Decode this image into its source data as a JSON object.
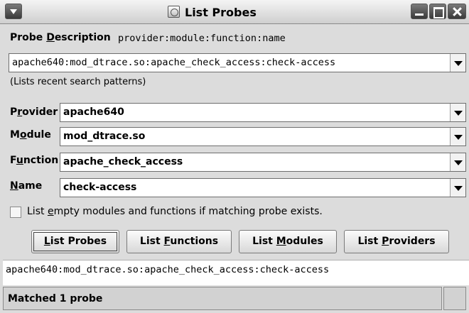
{
  "window": {
    "title": "List Probes"
  },
  "probe_description": {
    "label_prefix": "Probe ",
    "label_mnemonic": "D",
    "label_rest": "escription",
    "format": "provider:module:function:name",
    "value": "apache640:mod_dtrace.so:apache_check_access:check-access",
    "hint": "(Lists recent search patterns)"
  },
  "fields": {
    "provider": {
      "label_pre": "P",
      "label_mnemonic": "r",
      "label_post": "ovider",
      "value": "apache640"
    },
    "module": {
      "label_pre": "M",
      "label_mnemonic": "o",
      "label_post": "dule",
      "value": "mod_dtrace.so"
    },
    "function": {
      "label_pre": "F",
      "label_mnemonic": "u",
      "label_post": "nction",
      "value": "apache_check_access"
    },
    "name": {
      "label_pre": "",
      "label_mnemonic": "N",
      "label_post": "ame",
      "value": "check-access"
    }
  },
  "checkbox": {
    "pre": "List ",
    "mnemonic": "e",
    "post": "mpty modules and functions if matching probe exists.",
    "checked": false
  },
  "buttons": {
    "list_probes": {
      "pre": "",
      "mnemonic": "L",
      "post": "ist Probes"
    },
    "list_functions": {
      "pre": "List ",
      "mnemonic": "F",
      "post": "unctions"
    },
    "list_modules": {
      "pre": "List ",
      "mnemonic": "M",
      "post": "odules"
    },
    "list_providers": {
      "pre": "List ",
      "mnemonic": "P",
      "post": "roviders"
    }
  },
  "result": {
    "text": "apache640:mod_dtrace.so:apache_check_access:check-access"
  },
  "status": {
    "text": "Matched 1 probe"
  }
}
